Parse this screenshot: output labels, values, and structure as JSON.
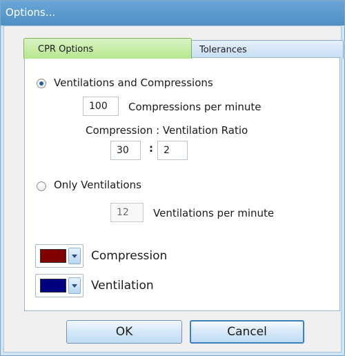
{
  "window": {
    "title": "Options..."
  },
  "tabs": [
    {
      "label": "CPR Options",
      "selected": true,
      "color": "#b6e68e"
    },
    {
      "label": "Tolerances",
      "selected": false
    }
  ],
  "cpr": {
    "mode_ventcomp_label": "Ventilations and Compressions",
    "mode_ventcomp_selected": true,
    "compressions_value": "100",
    "compressions_label": "Compressions per minute",
    "ratio_label": "Compression : Ventilation Ratio",
    "ratio_compression": "30",
    "ratio_separator": ":",
    "ratio_ventilation": "2",
    "mode_ventonly_label": "Only Ventilations",
    "mode_ventonly_selected": false,
    "ventilations_value": "12",
    "ventilations_label": "Ventilations per minute"
  },
  "colors": {
    "compression_label": "Compression",
    "compression_color": "#800000",
    "ventilation_label": "Ventilation",
    "ventilation_color": "#000080"
  },
  "buttons": {
    "ok": "OK",
    "cancel": "Cancel"
  }
}
